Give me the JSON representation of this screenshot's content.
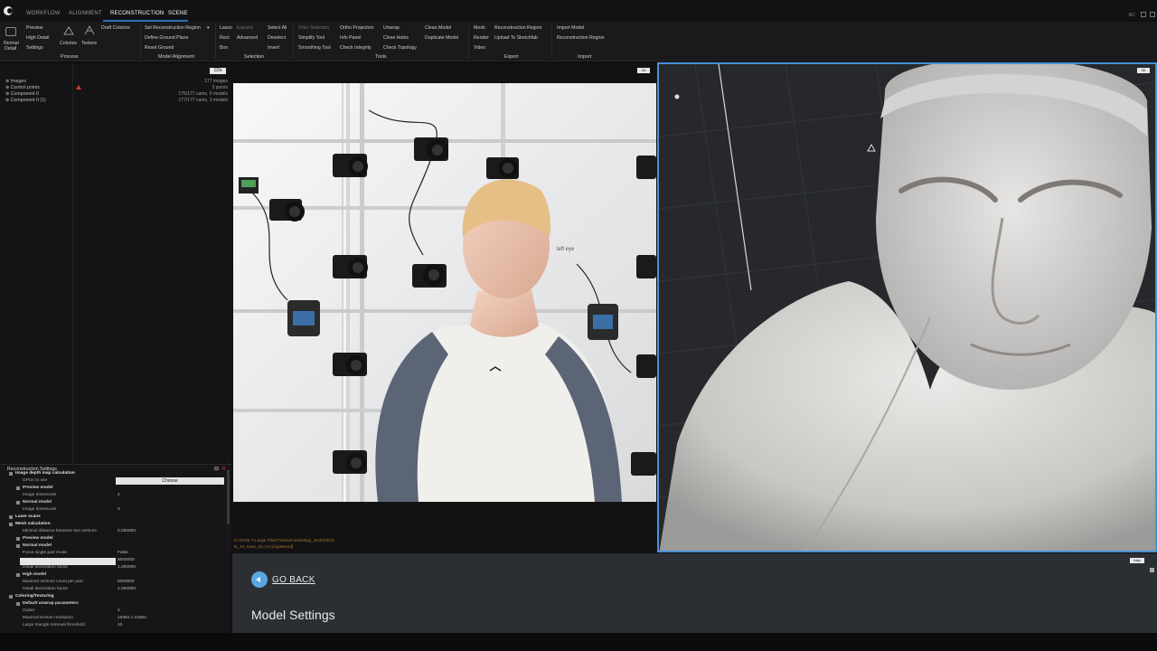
{
  "tabs": [
    "WORKFLOW",
    "ALIGNMENT",
    "RECONSTRUCTION",
    "SCENE"
  ],
  "tab_active": "RECONSTRUCTION",
  "rc_label": "RC",
  "ribbon": {
    "process": {
      "normal": "Normal",
      "detail": "Detail",
      "preview": "Preview",
      "high_detail": "High Detail",
      "settings": "Settings",
      "colorize": "Colorize",
      "texture": "Texture",
      "draft_colorize": "Draft Colorize",
      "group": "Process"
    },
    "model_alignment": {
      "set_region": "Set Reconstruction Region",
      "define_ground": "Define Ground Plane",
      "reset_ground": "Reset Ground",
      "group": "Model Alignment"
    },
    "selection": {
      "lasso": "Lasso",
      "rect": "Rect",
      "box": "Box",
      "expand": "Expand",
      "advanced": "Advanced",
      "select_all": "Select All",
      "deselect": "Deselect",
      "invert": "Invert",
      "group": "Selection"
    },
    "tools": {
      "filter_selection": "Filter Selection",
      "simplify_tool": "Simplify Tool",
      "smoothing_tool": "Smoothing Tool",
      "ortho_projection": "Ortho Projection",
      "info_panel": "Info Panel",
      "check_integrity": "Check Integrity",
      "unwrap": "Unwrap",
      "close_holes": "Close Holes",
      "check_topology": "Check Topology",
      "clean_model": "Clean Model",
      "duplicate_model": "Duplicate Model",
      "group": "Tools"
    },
    "export": {
      "mesh": "Mesh",
      "render": "Render",
      "video": "Video",
      "reconstruction_region": "Reconstruction Region",
      "upload": "Upload To Sketchfab",
      "group": "Export"
    },
    "import": {
      "import_model": "Import Model",
      "reconstruction_region": "Reconstruction Region",
      "group": "Import"
    }
  },
  "left_pane": {
    "tag": "1Ds",
    "tree": [
      {
        "label": "Images",
        "value": "177 images"
      },
      {
        "label": "Control points",
        "value": "3 points"
      },
      {
        "label": "Component 0",
        "value": "175/177 cams, 0 models"
      },
      {
        "label": "Component 0 (1)",
        "value": "177/177 cams, 3 models"
      }
    ]
  },
  "settings": {
    "title": "Reconstruction Settings",
    "choose_label": "Choose",
    "rows": [
      {
        "type": "sec",
        "k": "Image depth map calculation",
        "v": ""
      },
      {
        "type": "row",
        "k": "GPUs to use",
        "v": ""
      },
      {
        "type": "sub",
        "k": "Preview model",
        "v": ""
      },
      {
        "type": "row",
        "k": "Image downscale",
        "v": "4"
      },
      {
        "type": "sub",
        "k": "Normal model",
        "v": ""
      },
      {
        "type": "row",
        "k": "Image downscale",
        "v": "3"
      },
      {
        "type": "sec",
        "k": "Laser scans",
        "v": ""
      },
      {
        "type": "sec",
        "k": "Mesh calculation",
        "v": ""
      },
      {
        "type": "row",
        "k": "Minimal distance between two vertices",
        "v": "0.000000"
      },
      {
        "type": "sub",
        "k": "Preview model",
        "v": ""
      },
      {
        "type": "sub",
        "k": "Normal model",
        "v": ""
      },
      {
        "type": "row",
        "k": "Force single part mode",
        "v": "False"
      },
      {
        "type": "row",
        "k": "Maximal vertices count per part",
        "v": "8000000"
      },
      {
        "type": "row",
        "k": "Detail decimation factor",
        "v": "1.000000"
      },
      {
        "type": "sub",
        "k": "High model",
        "v": ""
      },
      {
        "type": "row",
        "k": "Maximal vertices count per part",
        "v": "5000000"
      },
      {
        "type": "row",
        "k": "Detail decimation factor",
        "v": "1.000000"
      },
      {
        "type": "sec",
        "k": "Coloring/Texturing",
        "v": ""
      },
      {
        "type": "sub",
        "k": "Default unwrap parameters",
        "v": ""
      },
      {
        "type": "row",
        "k": "Gutter",
        "v": "2"
      },
      {
        "type": "row",
        "k": "Maximal texture resolution",
        "v": "16384 x 16384"
      },
      {
        "type": "row",
        "k": "Large triangle removal threshold",
        "v": "10"
      }
    ]
  },
  "image_view": {
    "tag": "2D",
    "annotation": "left eye",
    "path_line1": "D:\\Tesla Y Large Files\\Tutorial work\\Digi_Jack\\2021\\",
    "path_line2": "B_19_Cam_02.cr2 [registered]"
  },
  "three_d_view": {
    "tag": "3D"
  },
  "help": {
    "go_back": "GO BACK",
    "title": "Model Settings",
    "help_tag": "help"
  },
  "colors": {
    "accent": "#4a90d9",
    "warning": "#d03a2d",
    "path": "#a5742e"
  }
}
